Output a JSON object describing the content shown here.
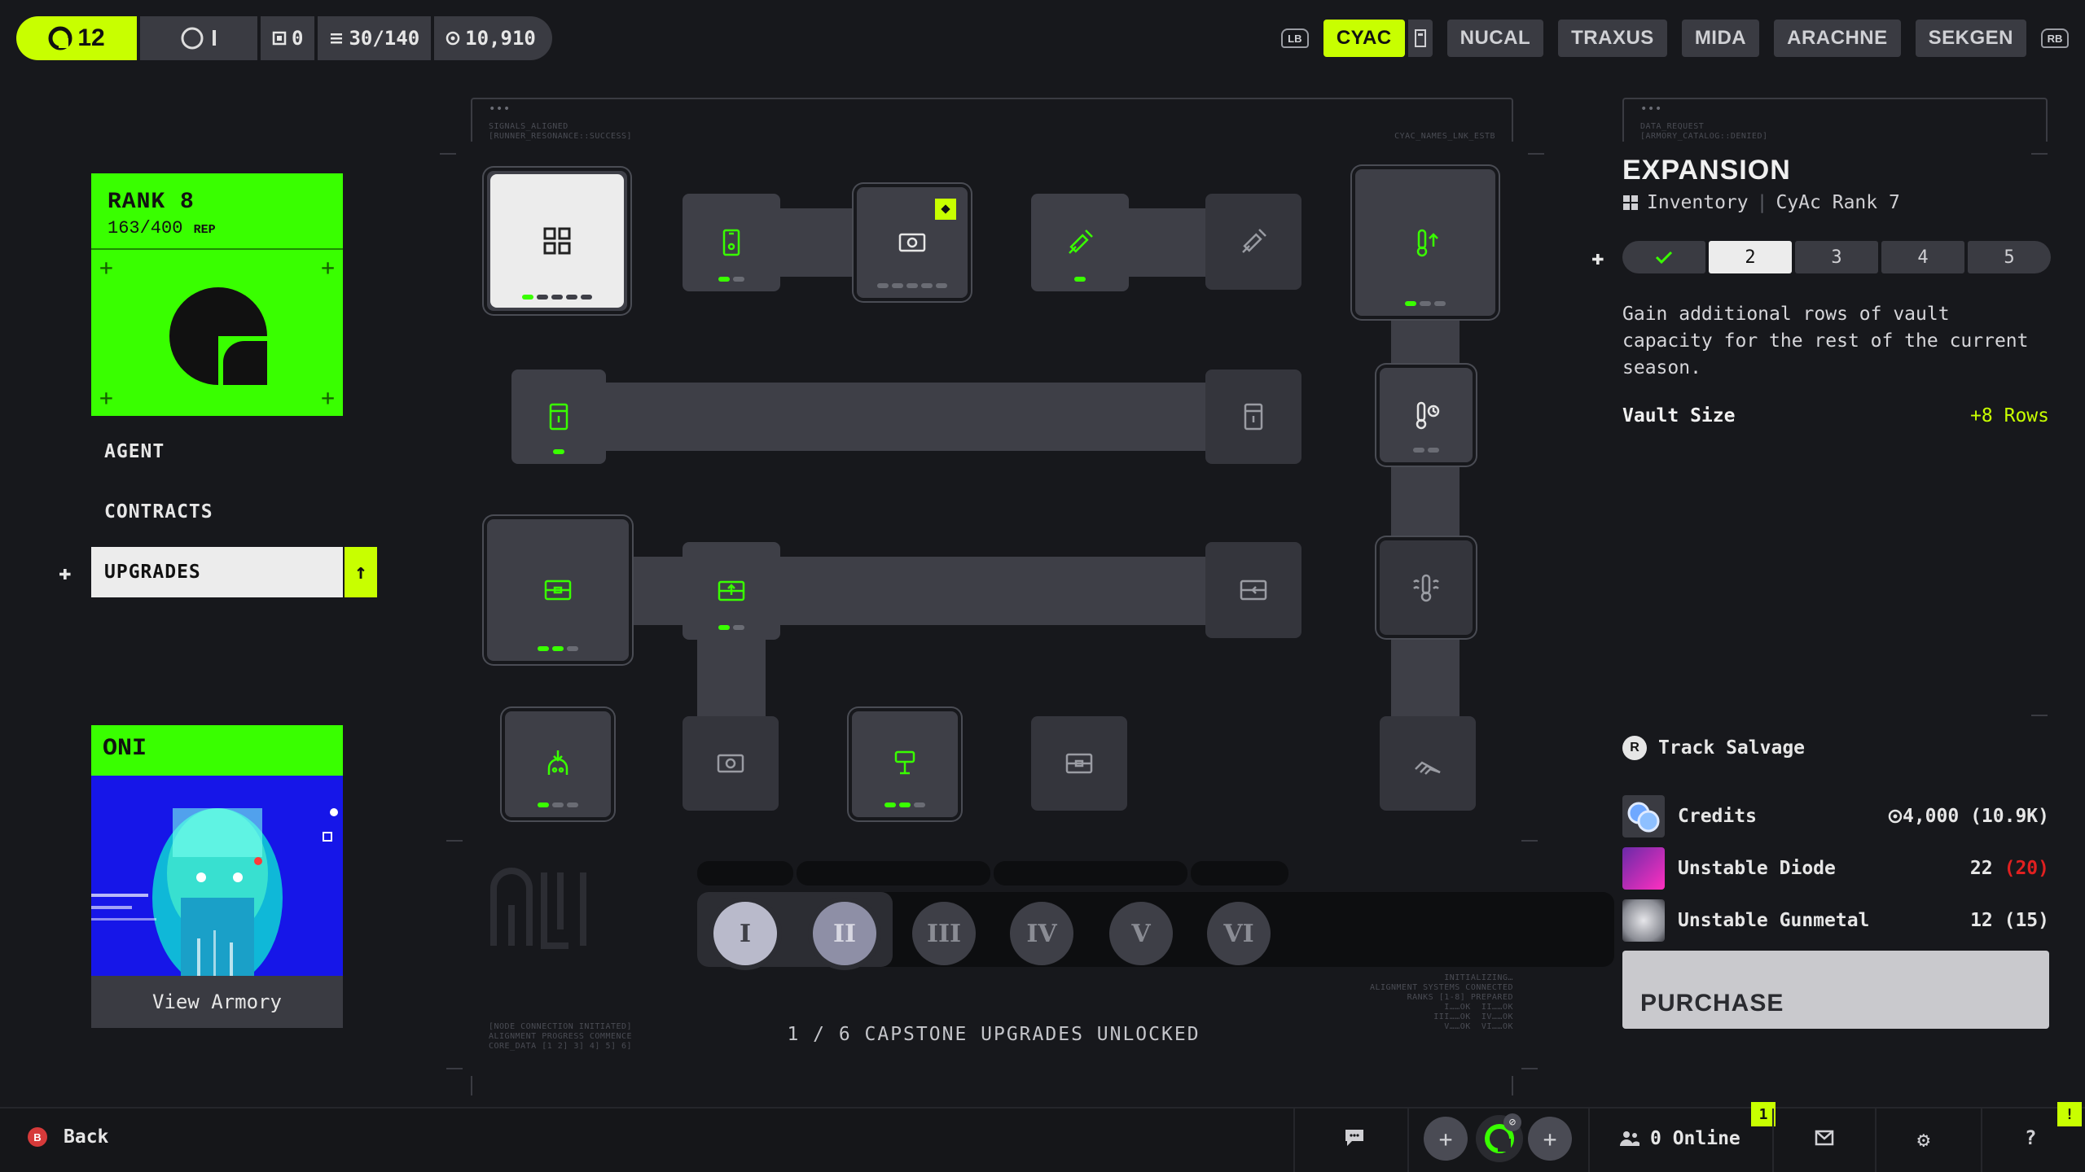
{
  "topbar": {
    "level": "12",
    "org_label": "I",
    "stat_a": "0",
    "stat_b": "30/140",
    "stat_c": "10,910"
  },
  "factions": {
    "lb": "LB",
    "rb": "RB",
    "items": [
      "CYAC",
      "NUCAL",
      "TRAXUS",
      "MIDA",
      "ARACHNE",
      "SEKGEN"
    ],
    "active": "CYAC"
  },
  "rank": {
    "title": "RANK 8",
    "progress": "163/400",
    "rep_label": "REP"
  },
  "nav": {
    "agent": "AGENT",
    "contracts": "CONTRACTS",
    "upgrades": "UPGRADES"
  },
  "oni": {
    "title": "ONI",
    "view_armory": "View Armory"
  },
  "grid": {
    "frame_left_tiny": "SIGNALS_ALIGNED\n[RUNNER_RESONANCE::SUCCESS]",
    "frame_right_tiny": "CYAC_NAMES_LNK_ESTB",
    "bottom_left_tiny": "[NODE CONNECTION INITIATED]\nALIGNMENT PROGRESS COMMENCE\nCORE_DATA [1 2] 3] 4] 5] 6]",
    "bottom_right_tiny": "INITIALIZING…\nALIGNMENT SYSTEMS CONNECTED\nRANKS [1-8] PREPARED\nI……OK  II……OK\nIII……OK  IV……OK\nV……OK  VI……OK",
    "capstones": [
      "I",
      "II",
      "III",
      "IV",
      "V",
      "VI"
    ],
    "caption": "1 / 6 CAPSTONE UPGRADES UNLOCKED"
  },
  "panel": {
    "frame_tiny": "DATA_REQUEST\n[ARMORY_CATALOG::DENIED]",
    "title": "EXPANSION",
    "category": "Inventory",
    "divider": "|",
    "requirement": "CyAc Rank 7",
    "tiers": [
      "2",
      "3",
      "4",
      "5"
    ],
    "description": "Gain additional rows of vault capacity for the rest of the current season.",
    "stat_label": "Vault Size",
    "stat_value": "+8 Rows",
    "track_salvage": "Track Salvage",
    "resources": [
      {
        "name": "Credits",
        "amount": "4,000 (10.9K)"
      },
      {
        "name": "Unstable Diode",
        "amount": "22",
        "owned": "(20)"
      },
      {
        "name": "Unstable Gunmetal",
        "amount": "12 (15)"
      }
    ],
    "purchase": "PURCHASE"
  },
  "bottombar": {
    "back": "Back",
    "back_key": "B",
    "online": "0 Online",
    "notif_count": "1",
    "alert": "!"
  },
  "colors": {
    "accent": "#c8ff00",
    "neon": "#39ff00",
    "panel": "#3e3f47",
    "bg": "#17181c",
    "deficit": "#e02020"
  }
}
